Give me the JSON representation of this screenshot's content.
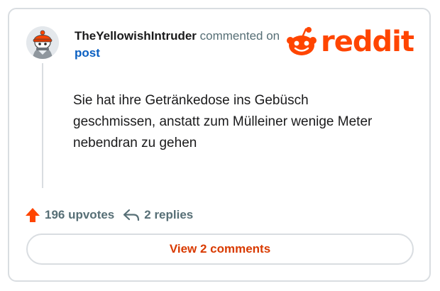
{
  "comment": {
    "username": "TheYellowishIntruder",
    "action_text": "commented on",
    "post_link": "post",
    "body": "Sie hat ihre Getränkedose ins Gebüsch geschmissen, anstatt zum Mülleiner wenige Meter nebendran zu gehen"
  },
  "logo": {
    "wordmark": "reddit",
    "icon": "reddit-snoo-icon"
  },
  "stats": {
    "upvotes": "196 upvotes",
    "upvote_icon": "upvote-arrow-icon",
    "replies": "2 replies",
    "reply_icon": "reply-arrow-icon"
  },
  "button": {
    "view_comments": "View 2 comments"
  },
  "colors": {
    "brand": "#ff4500",
    "link": "#0a5fc1",
    "button_text": "#d93a00",
    "muted": "#576f76",
    "border": "#d9dde1"
  }
}
